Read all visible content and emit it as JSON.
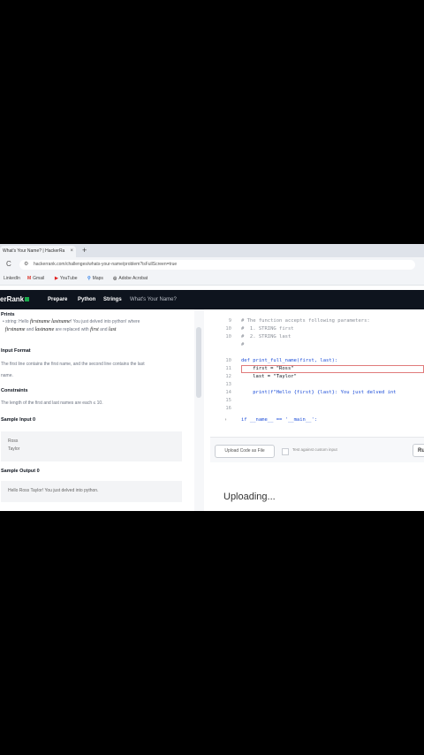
{
  "browser": {
    "tab_title": "What's Your Name? | HackerRa",
    "tab_close": "×",
    "new_tab": "+",
    "reload": "C",
    "url": "hackerrank.com/challenges/whats-your-name/problem?isFullScreen=true",
    "bookmarks": [
      {
        "icon": "",
        "label": "LinkedIn"
      },
      {
        "icon": "M",
        "label": "Gmail"
      },
      {
        "icon": "▶",
        "label": "YouTube"
      },
      {
        "icon": "⚲",
        "label": "Maps"
      },
      {
        "icon": "◎",
        "label": "Adobe Acrobat"
      }
    ]
  },
  "nav": {
    "logo": "erRank",
    "items": [
      "Prepare",
      "Python",
      "Strings",
      "What's Your Name?"
    ]
  },
  "problem": {
    "prints_heading": "Prints",
    "prints_text_a": "string: Hello",
    "prints_math_a": "firstname lastname",
    "prints_text_b": "! You just delved into python! where",
    "prints_math_b": "firstname",
    "prints_text_c": "and",
    "prints_math_c": "lastname",
    "prints_text_d": "are replaced with",
    "prints_math_d": "first",
    "prints_text_e": "and",
    "prints_math_e": "last",
    "input_format_heading": "Input Format",
    "input_format_line1": "The first line contains the first name, and the second line contains the last",
    "input_format_line2": "name.",
    "constraints_heading": "Constraints",
    "constraints_text": "The length of the first and last names are each ≤ 10.",
    "sample_input_heading": "Sample Input 0",
    "sample_input": [
      "Ross",
      "Taylor"
    ],
    "sample_output_heading": "Sample Output 0",
    "sample_output": "Hello Ross Taylor! You just delved into python."
  },
  "editor": {
    "lines": [
      {
        "n": "9",
        "text": "# The function accepts following parameters:"
      },
      {
        "n": "10",
        "text": "#  1. STRING first"
      },
      {
        "n": "10",
        "text": "#  2. STRING last"
      },
      {
        "n": "",
        "text": "#"
      },
      {
        "n": "",
        "text": ""
      },
      {
        "n": "10",
        "text": "def print_full_name(first, last):"
      },
      {
        "n": "11",
        "text": "    first = \"Ross\""
      },
      {
        "n": "12",
        "text": "    last = \"Taylor\""
      },
      {
        "n": "13",
        "text": ""
      },
      {
        "n": "14",
        "text": "    print(f\"Hello {first} {last}: You just delved int"
      },
      {
        "n": "15",
        "text": ""
      },
      {
        "n": "16",
        "text": ""
      },
      {
        "n": "16",
        "text": "if __name__ == '__main__':"
      }
    ]
  },
  "actions": {
    "upload_label": "Upload Code as File",
    "custom_input_label": "Test against custom input",
    "run_label": "Ru"
  },
  "status": {
    "uploading": "Uploading..."
  }
}
